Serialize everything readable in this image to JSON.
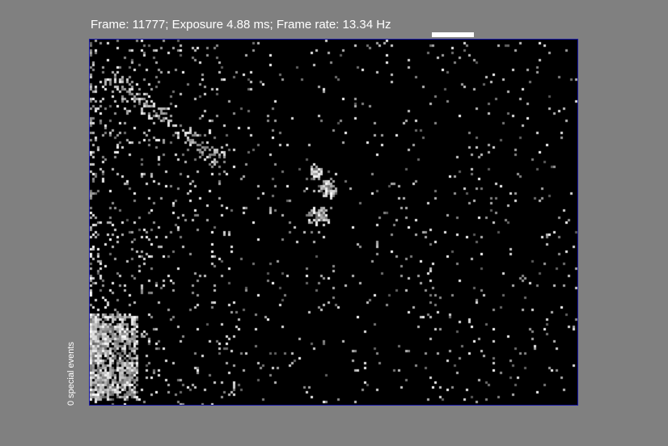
{
  "status": {
    "text": "Frame: 11777; Exposure 4.88 ms; Frame rate: 13.34 Hz",
    "frame": 11777,
    "exposure_ms": 4.88,
    "frame_rate_hz": 13.34
  },
  "progress": {
    "fraction": 1.0
  },
  "side_label": "0 special events",
  "colors": {
    "background": "#808080",
    "frame_border": "#1a1aa8",
    "image_background": "#000000",
    "text": "#ffffff"
  }
}
